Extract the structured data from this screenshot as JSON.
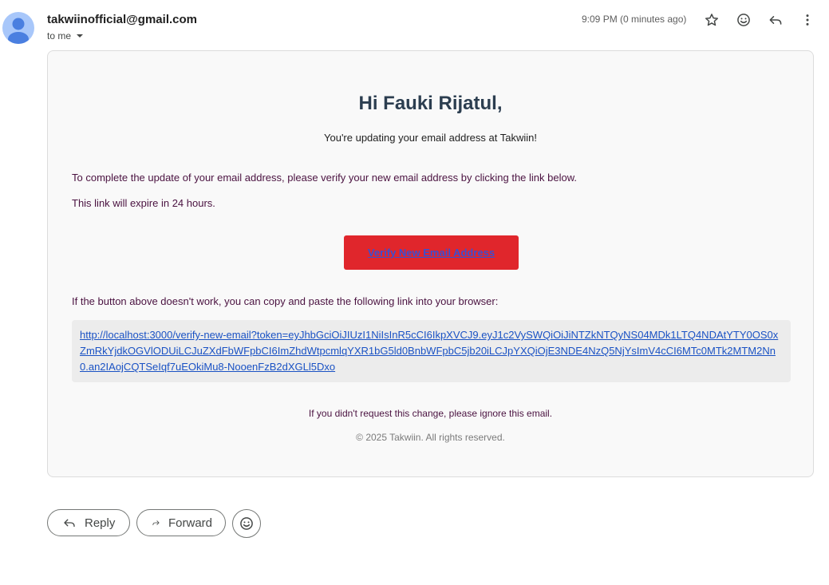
{
  "header": {
    "sender": "takwiinofficial@gmail.com",
    "recipient": "to me",
    "timestamp": "9:09 PM (0 minutes ago)",
    "icons": [
      "star-icon",
      "emoji-icon",
      "reply-icon",
      "more-vert-icon"
    ]
  },
  "email": {
    "greeting": "Hi Fauki Rijatul,",
    "intro": "You're updating your email address at Takwiin!",
    "instruction": "To complete the update of your email address, please verify your new email address by clicking the link below.",
    "expiry": "This link will expire in 24 hours.",
    "verify_button": "Verify New Email Address",
    "fallback_text": "If the button above doesn't work, you can copy and paste the following link into your browser:",
    "link_lines": [
      "http://localhost:3000/verify-new-email?token=eyJhbGciOiJIUzI1NiIsInR5cCI6IkpXVCJ9.eyJ1c2VySWQiOiJiNTZkNTQyNS04MDk1LTQ4NDAtYTY0OS0x",
      "ZmRkYjdkOGVlODUiLCJuZXdFbWFpbCI6ImZhdWtpcmlqYXR1bG5ld0BnbWFpbC5jb20iLCJpYXQiOjE3NDE4NzQ5NjYsImV4cCI6MTc0MTk2MTM2Nn",
      "0.an2IAojCQTSeIqf7uEOkiMu8-NooenFzB2dXGLl5Dxo"
    ],
    "ignore_text": "If you didn't request this change, please ignore this email.",
    "copyright": "© 2025 Takwiin. All rights reserved."
  },
  "actions": {
    "reply": "Reply",
    "forward": "Forward"
  },
  "colors": {
    "verify_button_bg": "#e0262c",
    "link": "#1a52c4",
    "heading": "#2c3e50",
    "avatar_bg": "#a8c7fa"
  }
}
